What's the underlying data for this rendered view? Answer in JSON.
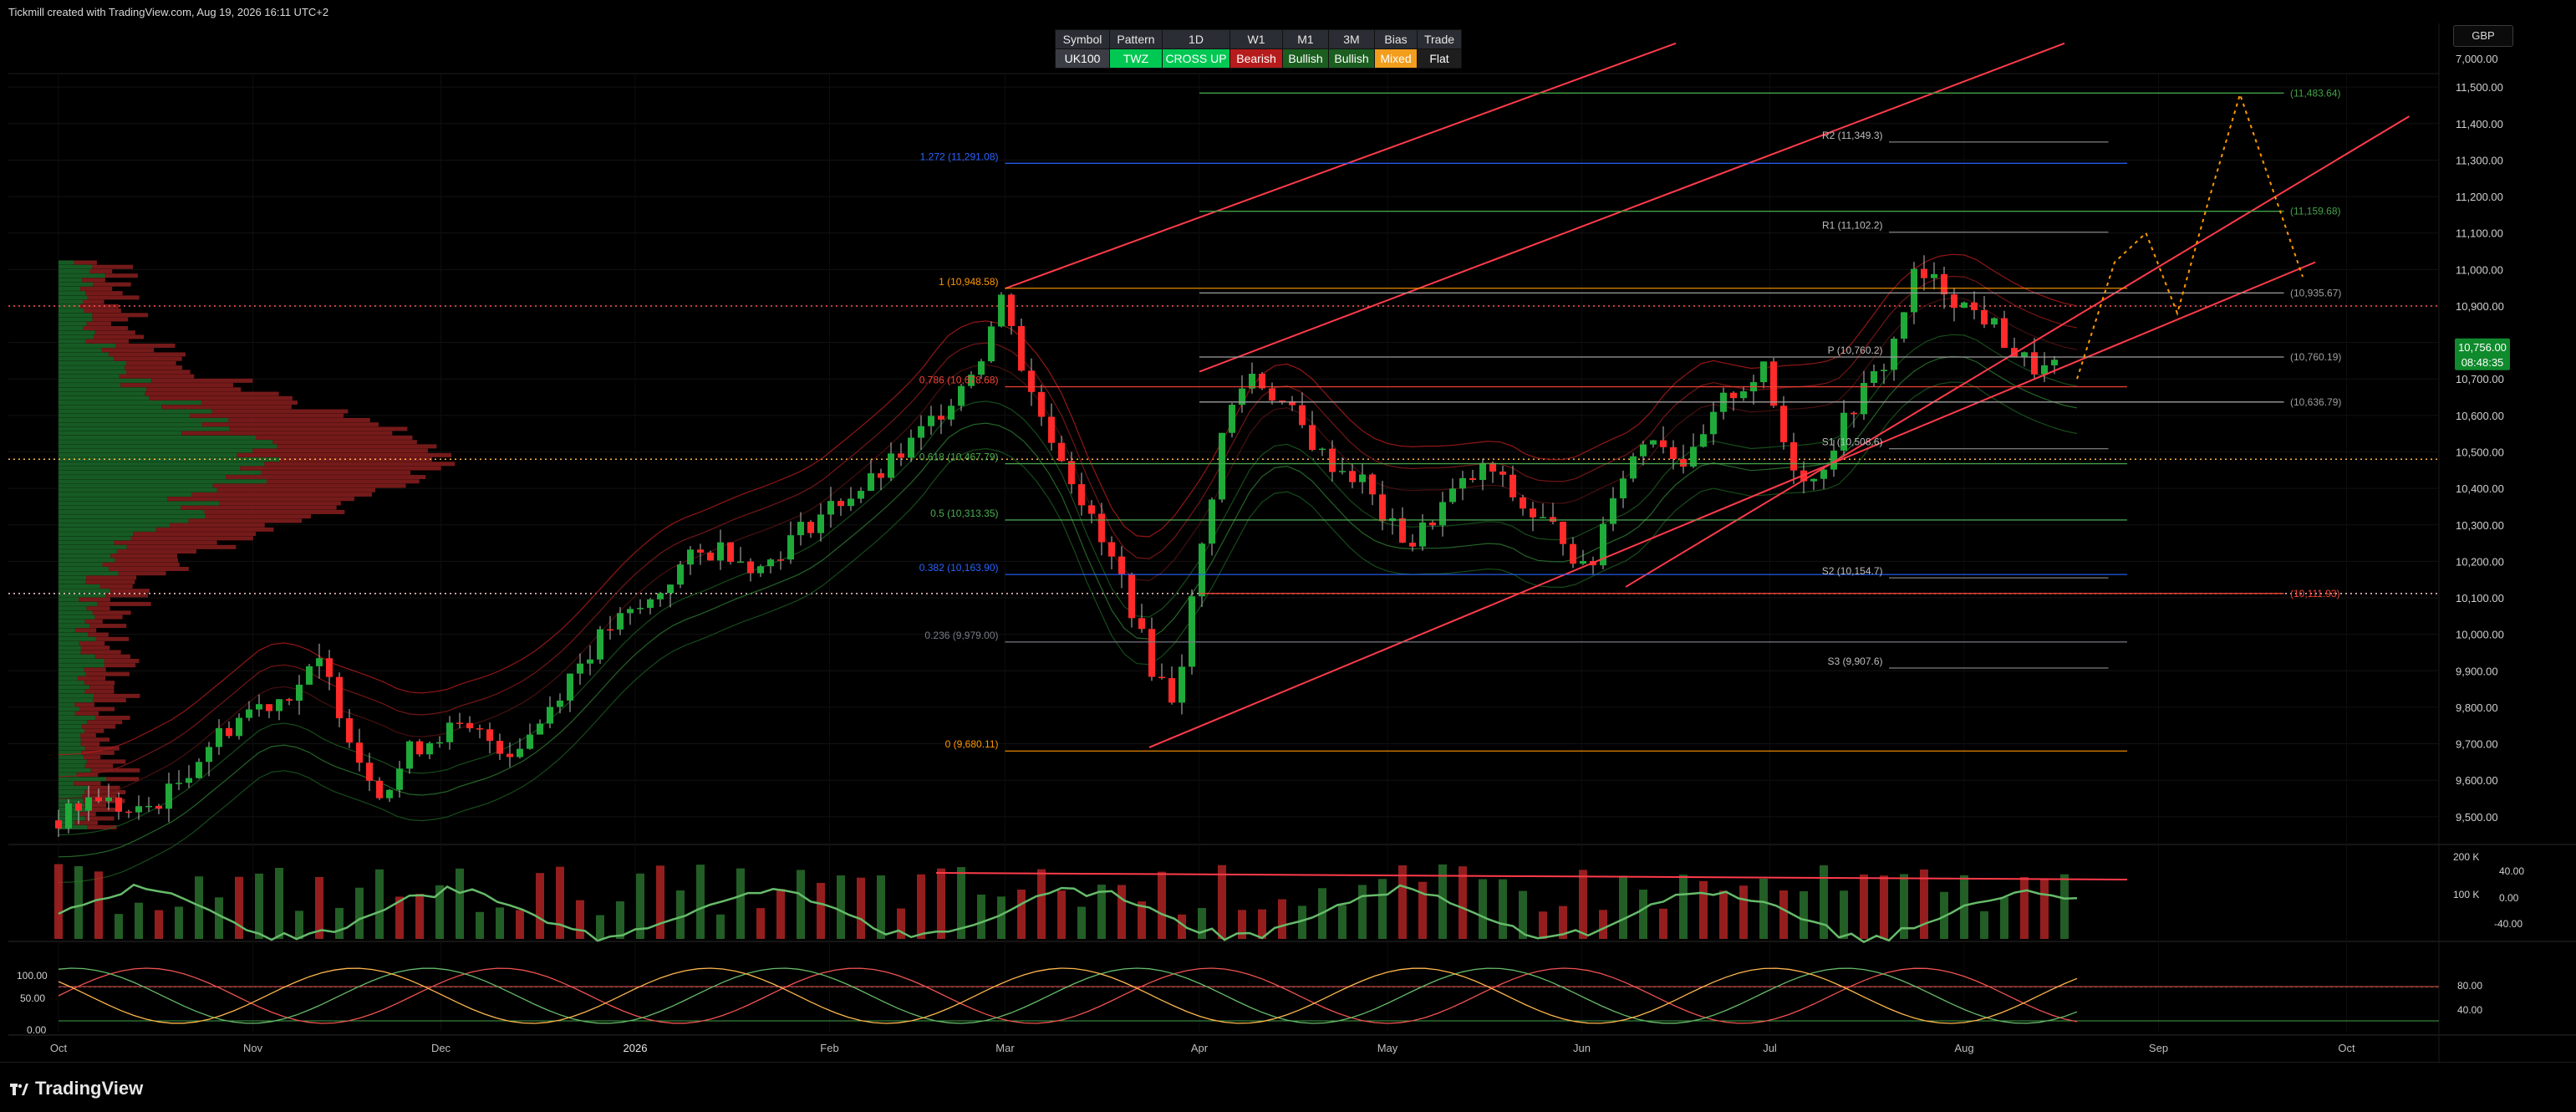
{
  "header": {
    "credit": "Tickmill created with TradingView.com, Aug 19, 2026 16:11 UTC+2"
  },
  "footer": {
    "brand": "TradingView"
  },
  "currency": "GBP",
  "bias_table": {
    "headers": [
      "Symbol",
      "Pattern",
      "1D",
      "W1",
      "M1",
      "3M",
      "Bias",
      "Trade"
    ],
    "values": [
      "UK100",
      "TWZ",
      "CROSS UP",
      "Bearish",
      "Bullish",
      "Bullish",
      "Mixed",
      "Flat"
    ],
    "value_colors": [
      "#3a3d44",
      "#00c853",
      "#00c853",
      "#b71c1c",
      "#1b5e20",
      "#1b5e20",
      "#f29d1c",
      "#1e1e1e"
    ]
  },
  "colors": {
    "up": "#1faa3a",
    "down": "#ff2a2a",
    "channel": "#ff3b4a",
    "fib_blue": "#2962ff",
    "fib_green": "#4caf50",
    "grid": "#121212"
  },
  "chart_data": [
    {
      "type": "line",
      "symbol": "UK100",
      "currency": "GBP",
      "x_ticks": [
        "Oct",
        "Nov",
        "Dec",
        "2026",
        "Feb",
        "Mar",
        "Apr",
        "May",
        "Jun",
        "Jul",
        "Aug",
        "Sep",
        "Oct"
      ],
      "x_tick_days": [
        0,
        31,
        61,
        92,
        123,
        151,
        182,
        212,
        243,
        273,
        304,
        335,
        365
      ],
      "y_ticks": [
        7000,
        9500,
        9600,
        9700,
        9800,
        9900,
        10000,
        10100,
        10200,
        10300,
        10400,
        10500,
        10600,
        10700,
        10800,
        10900,
        11000,
        11100,
        11200,
        11300,
        11400,
        11500
      ],
      "y_tick_labels": [
        "7,000.00",
        "9,500.00",
        "9,600.00",
        "9,700.00",
        "9,800.00",
        "9,900.00",
        "10,000.00",
        "10,100.00",
        "10,200.00",
        "10,300.00",
        "10,400.00",
        "10,500.00",
        "10,600.00",
        "10,700.00",
        "10,800.00",
        "10,900.00",
        "11,000.00",
        "11,100.00",
        "11,200.00",
        "11,300.00",
        "11,400.00",
        "11,500.00"
      ],
      "ylim": [
        9440,
        11560
      ],
      "last_price": "10,756.00",
      "countdown": "08:48:35",
      "price_path": {
        "day": [
          0,
          6,
          12,
          18,
          24,
          30,
          36,
          42,
          48,
          52,
          56,
          62,
          68,
          72,
          76,
          82,
          88,
          94,
          100,
          106,
          112,
          118,
          124,
          130,
          136,
          142,
          147,
          151,
          154,
          158,
          162,
          166,
          170,
          174,
          178,
          182,
          186,
          190,
          196,
          202,
          208,
          212,
          216,
          222,
          228,
          234,
          240,
          244,
          248,
          254,
          260,
          266,
          272,
          276,
          280,
          286,
          292,
          296,
          300,
          304,
          308,
          312,
          316,
          320
        ],
        "close": [
          9490,
          9560,
          9500,
          9570,
          9700,
          9790,
          9830,
          9920,
          9660,
          9560,
          9680,
          9740,
          9720,
          9680,
          9740,
          9900,
          10020,
          10080,
          10200,
          10240,
          10180,
          10280,
          10360,
          10420,
          10520,
          10640,
          10760,
          10948,
          10700,
          10560,
          10420,
          10260,
          10140,
          9920,
          9820,
          10200,
          10580,
          10720,
          10620,
          10480,
          10420,
          10300,
          10250,
          10380,
          10460,
          10340,
          10270,
          10150,
          10400,
          10560,
          10460,
          10650,
          10720,
          10480,
          10420,
          10620,
          10760,
          10980,
          10960,
          10900,
          10860,
          10770,
          10720,
          10740
        ]
      },
      "fib_levels": [
        {
          "label": "1.272 (11,291.08)",
          "value": 11291.08,
          "color": "#2962ff"
        },
        {
          "label": "1 (10,948.58)",
          "value": 10948.58,
          "color": "#ff9800"
        },
        {
          "label": "0.786 (10,678.68)",
          "value": 10678.68,
          "color": "#f44336"
        },
        {
          "label": "0.618 (10,467.79)",
          "value": 10467.79,
          "color": "#4caf50"
        },
        {
          "label": "0.5 (10,313.35)",
          "value": 10313.35,
          "color": "#4caf50"
        },
        {
          "label": "0.382 (10,163.90)",
          "value": 10163.9,
          "color": "#2962ff"
        },
        {
          "label": "0.236 (9,979.00)",
          "value": 9979.0,
          "color": "#787b86"
        },
        {
          "label": "0 (9,680.11)",
          "value": 9680.11,
          "color": "#ff9800"
        }
      ],
      "pivots": [
        {
          "label": "R2 (11,349.3)",
          "value": 11349.3
        },
        {
          "label": "R1 (11,102.2)",
          "value": 11102.2
        },
        {
          "label": "P (10,760.2)",
          "value": 10760.2
        },
        {
          "label": "S1 (10,508.6)",
          "value": 10508.6
        },
        {
          "label": "S2 (10,154.7)",
          "value": 10154.7
        },
        {
          "label": "S3 (9,907.6)",
          "value": 9907.6
        }
      ],
      "levels": [
        {
          "label": "(11,483.64)",
          "value": 11483.64,
          "color": "#43a047"
        },
        {
          "label": "(11,159.68)",
          "value": 11159.68,
          "color": "#43a047"
        },
        {
          "label": "(10,935.67)",
          "value": 10935.67,
          "color": "#9e9e9e"
        },
        {
          "label": "(10,760.19)",
          "value": 10760.19,
          "color": "#9e9e9e"
        },
        {
          "label": "(10,636.79)",
          "value": 10636.79,
          "color": "#9e9e9e"
        },
        {
          "label": "(10,111.93)",
          "value": 10111.93,
          "color": "#f44336"
        }
      ]
    },
    {
      "type": "bar",
      "panel": "volume",
      "y_tick_labels": [
        "200 K",
        "100 K",
        "40.00",
        "0.00",
        "-40.00"
      ]
    },
    {
      "type": "line",
      "panel": "stochastic",
      "y_tick_labels": [
        "100.00",
        "50.00",
        "0.00",
        "80.00",
        "40.00"
      ]
    }
  ]
}
